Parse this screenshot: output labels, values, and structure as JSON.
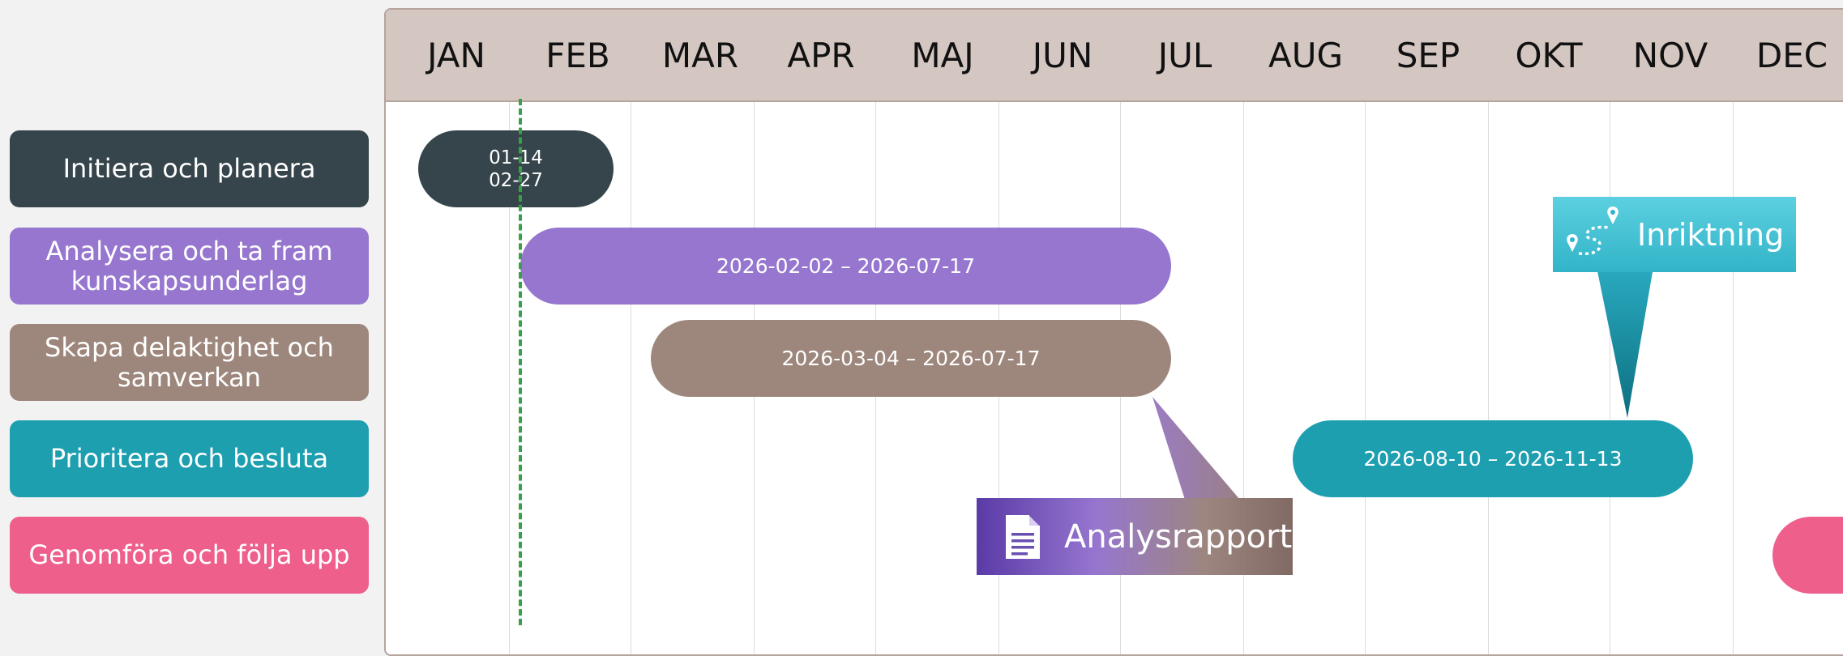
{
  "months": [
    "JAN",
    "FEB",
    "MAR",
    "APR",
    "MAJ",
    "JUN",
    "JUL",
    "AUG",
    "SEP",
    "OKT",
    "NOV",
    "DEC"
  ],
  "rows": [
    {
      "label": "Initiera och planera",
      "color": "#36454b",
      "bar": "01-14\n02-27",
      "bar_start": "01-14",
      "bar_end": "02-27"
    },
    {
      "label": "Analysera och ta fram kunskapsunderlag",
      "color": "#9676cf",
      "bar": "2026-02-02 – 2026-07-17"
    },
    {
      "label": "Skapa delaktighet och samverkan",
      "color": "#9d877c",
      "bar": "2026-03-04 – 2026-07-17"
    },
    {
      "label": "Prioritera och besluta",
      "color": "#1e9fb0",
      "bar": "2026-08-10 – 2026-11-13"
    },
    {
      "label": "Genomföra och följa upp",
      "color": "#ee5f8b",
      "bar": ""
    }
  ],
  "milestones": [
    {
      "label": "Analysrapport",
      "icon": "document-icon"
    },
    {
      "label": "Inriktning",
      "icon": "route-icon"
    }
  ],
  "today_line_color": "#3aa047"
}
